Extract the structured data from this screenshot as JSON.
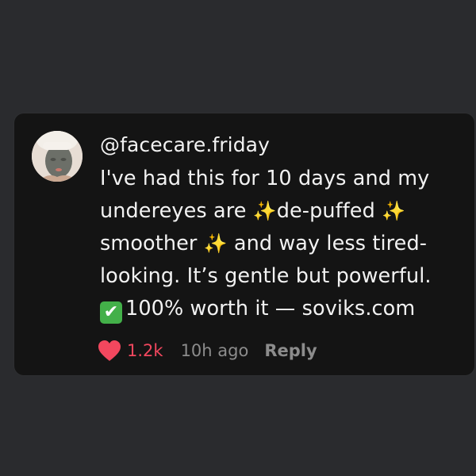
{
  "comment": {
    "username": "@facecare.friday",
    "lines": [
      {
        "before": "I've had this for 10 days and my",
        "emoji": "",
        "after": "",
        "emoji2": ""
      },
      {
        "before": "undereyes are ",
        "emoji": "✨",
        "after": "de-puffed ",
        "emoji2": "✨"
      },
      {
        "before": "smoother ",
        "emoji": "✨",
        "after": " and way less tired-",
        "emoji2": ""
      },
      {
        "before": "looking. It’s gentle but powerful.",
        "emoji": "",
        "after": "",
        "emoji2": ""
      },
      {
        "before": "",
        "emoji": "✔",
        "after": "100% worth it — soviks.com",
        "emoji2": ""
      }
    ],
    "likes": "1.2k",
    "time": "10h ago",
    "reply_label": "Reply"
  },
  "icons": {
    "avatar": "avatar-face-mask",
    "sparkle": "sparkles-icon",
    "check": "check-mark-button-icon",
    "heart": "heart-icon"
  },
  "colors": {
    "background": "#2a2b2e",
    "card": "#141414",
    "text": "#f2f2f2",
    "muted": "#8c8c8c",
    "like": "#f2475e",
    "check": "#43b049",
    "sparkle": "#f5c84a"
  }
}
